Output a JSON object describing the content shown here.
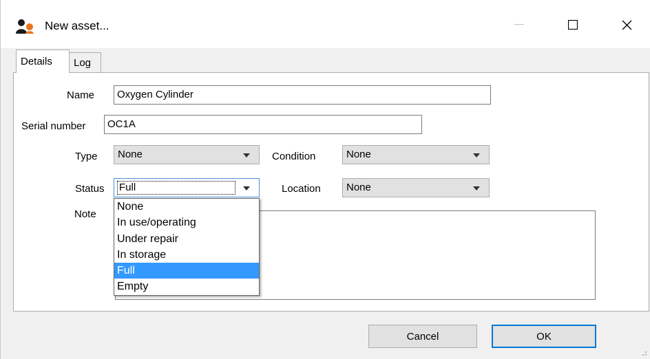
{
  "window": {
    "title": "New asset...",
    "icon": "people-icon",
    "controls": {
      "minimize": "minimize-icon",
      "maximize": "maximize-icon",
      "close": "close-icon"
    }
  },
  "tabs": [
    {
      "label": "Details",
      "active": true
    },
    {
      "label": "Log",
      "active": false
    }
  ],
  "form": {
    "name_label": "Name",
    "name_value": "Oxygen Cylinder",
    "serial_label": "Serial number",
    "serial_value": "OC1A",
    "type_label": "Type",
    "type_value": "None",
    "condition_label": "Condition",
    "condition_value": "None",
    "status_label": "Status",
    "status_value": "Full",
    "location_label": "Location",
    "location_value": "None",
    "note_label": "Note",
    "note_value": ""
  },
  "status_dropdown": {
    "options": [
      "None",
      "In use/operating",
      "Under repair",
      "In storage",
      "Full",
      "Empty"
    ],
    "selected": "Full"
  },
  "buttons": {
    "cancel": "Cancel",
    "ok": "OK"
  },
  "colors": {
    "selection": "#3399ff",
    "default_button_border": "#0078d7"
  }
}
